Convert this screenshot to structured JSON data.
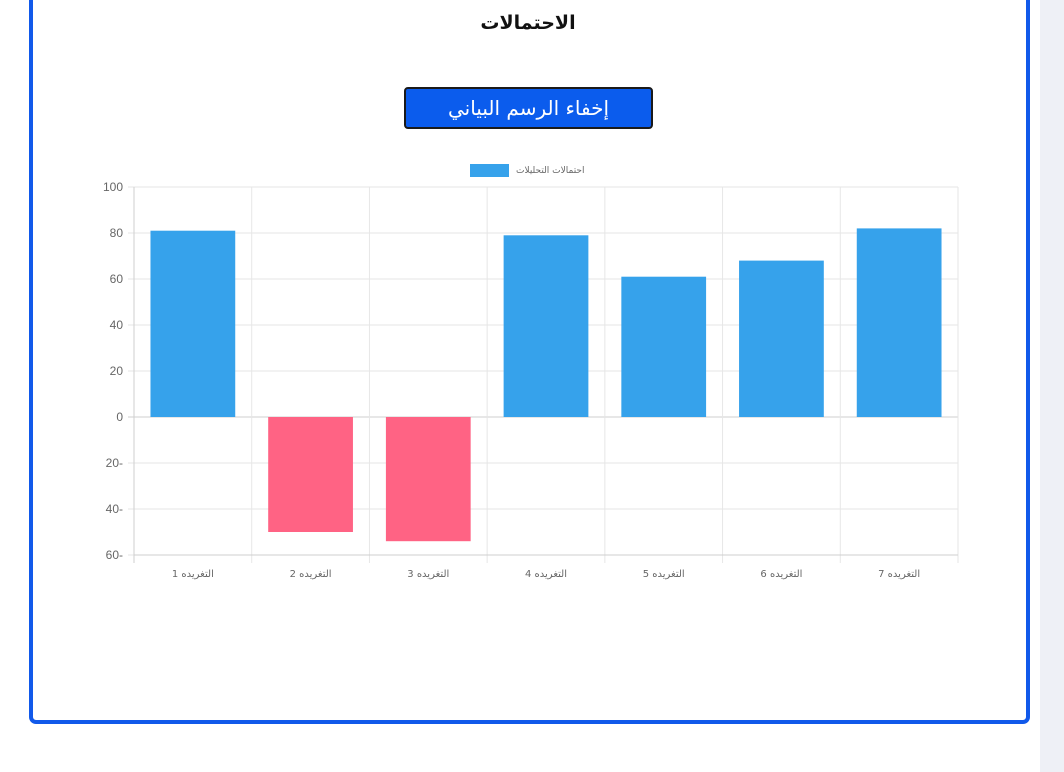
{
  "page": {
    "title": "الاحتمالات"
  },
  "toggle_button": {
    "label": "إخفاء الرسم البياني"
  },
  "colors": {
    "border": "#1159ea",
    "button_bg": "#0b5ced",
    "positive_bar": "#36a2eb",
    "negative_bar": "#ff6384"
  },
  "chart_data": {
    "type": "bar",
    "categories": [
      "التغريده 1",
      "التغريده 2",
      "التغريده 3",
      "التغريده 4",
      "التغريده 5",
      "التغريده 6",
      "التغريده 7"
    ],
    "series": [
      {
        "name": "احتمالات التحليلات",
        "values": [
          81,
          -50,
          -54,
          79,
          61,
          68,
          82
        ]
      }
    ],
    "ylim": [
      -60,
      100
    ],
    "yticks": [
      100,
      80,
      60,
      40,
      20,
      0,
      -20,
      -40,
      -60
    ],
    "ytick_labels": [
      "100",
      "80",
      "60",
      "40",
      "20",
      "0",
      "20-",
      "40-",
      "60-"
    ],
    "grid": true,
    "legend_position": "top"
  }
}
